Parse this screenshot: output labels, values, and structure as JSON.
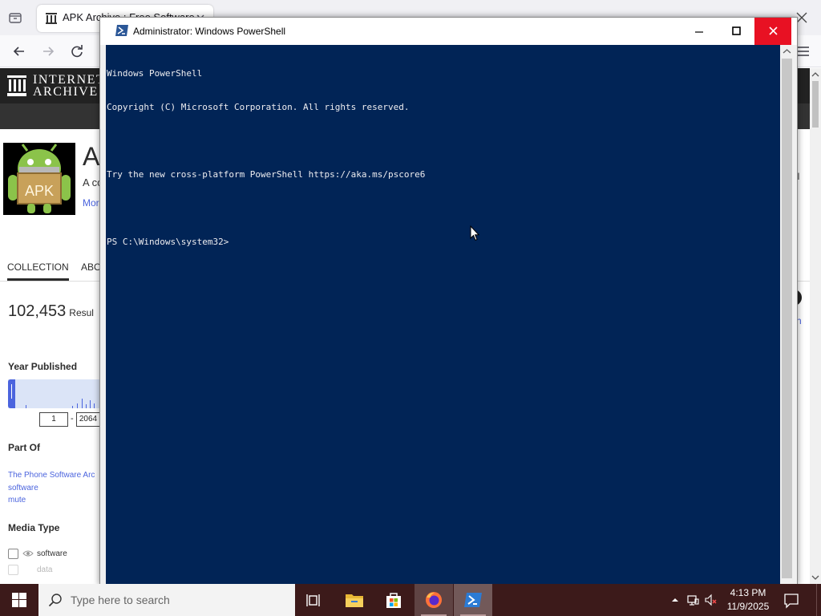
{
  "browser": {
    "tab_title": "APK Archive : Free Software : F",
    "page": {
      "logo_line1": "INTERNET",
      "logo_line2": "ARCHIVE",
      "collection_title_fragment": "A",
      "collection_desc_fragment": "A co",
      "more_link_fragment": "Mor",
      "tabs": {
        "collection": "COLLECTION",
        "about_fragment": "ABO"
      },
      "results_count": "102,453",
      "results_label_fragment": "Resul",
      "facets": {
        "year_published": "Year Published",
        "year_min": "1",
        "year_dash": "-",
        "year_max_fragment": "2064",
        "part_of": "Part Of",
        "part_of_links": [
          "The Phone Software Arc",
          "software",
          "mute"
        ],
        "media_type": "Media Type",
        "media_types": [
          "software",
          "data"
        ]
      },
      "right_fragments": {
        "letters": "ll",
        "link": "h"
      }
    }
  },
  "powershell": {
    "title": "Administrator: Windows PowerShell",
    "console_lines": [
      "Windows PowerShell",
      "Copyright (C) Microsoft Corporation. All rights reserved.",
      "",
      "Try the new cross-platform PowerShell https://aka.ms/pscore6",
      "",
      "PS C:\\Windows\\system32>"
    ],
    "colors": {
      "background": "#012456",
      "foreground": "#eeedf0",
      "close_hover": "#e81123"
    }
  },
  "taskbar": {
    "search_placeholder": "Type here to search",
    "items": [
      "task-view-icon",
      "file-explorer-icon",
      "microsoft-store-icon",
      "firefox-icon",
      "powershell-icon"
    ],
    "time": "4:13 PM",
    "date": "11/9/2025",
    "colors": {
      "background": "#3c1a1a"
    }
  }
}
